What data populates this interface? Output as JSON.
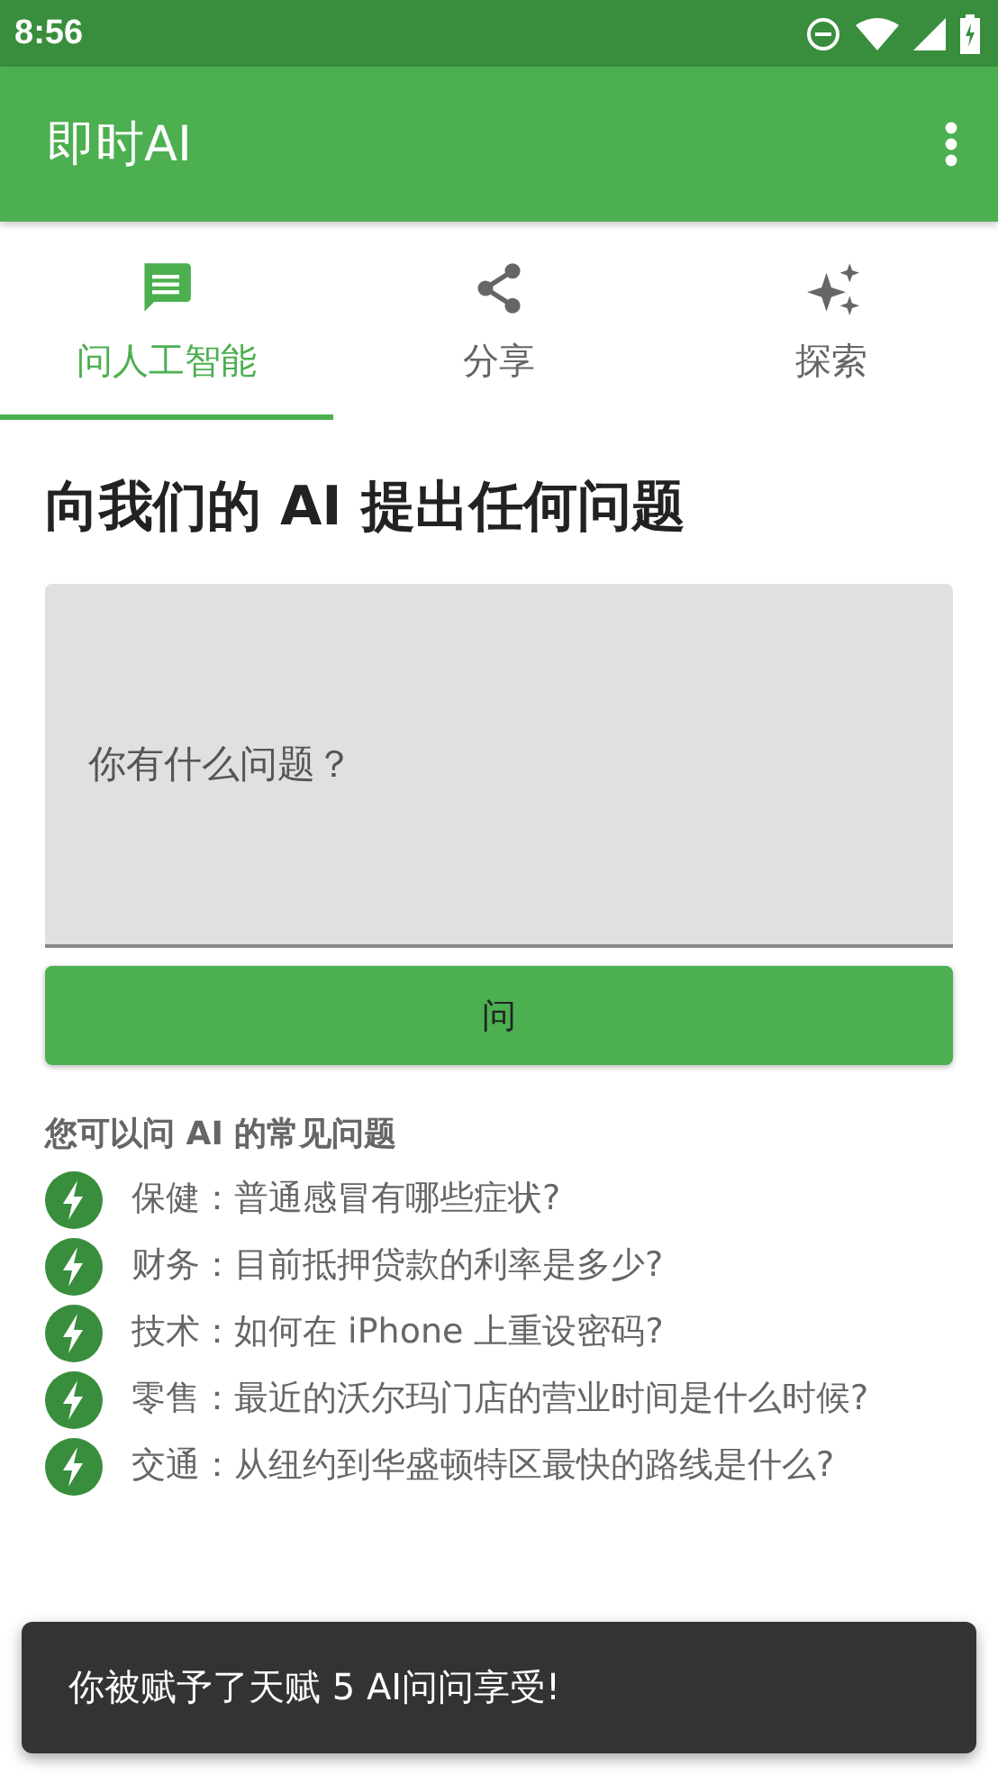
{
  "status_bar": {
    "time": "8:56"
  },
  "app_bar": {
    "title": "即时AI"
  },
  "tabs": [
    {
      "label": "问人工智能",
      "kind": "chat",
      "selected": true
    },
    {
      "label": "分享",
      "kind": "share",
      "selected": false
    },
    {
      "label": "探索",
      "kind": "sparkle",
      "selected": false
    }
  ],
  "heading": "向我们的 AI 提出任何问题",
  "question_field": {
    "placeholder": "你有什么问题？"
  },
  "ask_button": "问",
  "faq": {
    "title": "您可以问 AI 的常见问题",
    "items": [
      "保健：普通感冒有哪些症状?",
      "财务：目前抵押贷款的利率是多少?",
      "技术：如何在 iPhone 上重设密码?",
      "零售：最近的沃尔玛门店的营业时间是什么时候?",
      "交通：从纽约到华盛顿特区最快的路线是什么?"
    ]
  },
  "snackbar": "你被赋予了天赋 5 AI问问享受!"
}
